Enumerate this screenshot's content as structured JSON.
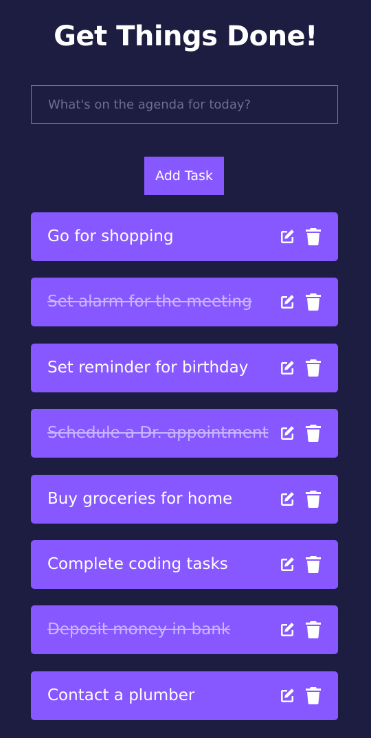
{
  "header": {
    "title": "Get Things Done!"
  },
  "form": {
    "placeholder": "What's on the agenda for today?",
    "add_label": "Add Task"
  },
  "tasks": [
    {
      "label": "Go for shopping",
      "completed": false
    },
    {
      "label": "Set alarm for the meeting",
      "completed": true
    },
    {
      "label": "Set reminder for birthday",
      "completed": false
    },
    {
      "label": "Schedule a Dr. appointment",
      "completed": true
    },
    {
      "label": "Buy groceries for home",
      "completed": false
    },
    {
      "label": "Complete coding tasks",
      "completed": false
    },
    {
      "label": "Deposit money in bank",
      "completed": true
    },
    {
      "label": "Contact a plumber",
      "completed": false
    }
  ],
  "icons": {
    "edit": "pen-to-square-icon",
    "delete": "trash-icon"
  },
  "colors": {
    "background": "#1d1d42",
    "accent": "#8758ff",
    "text": "#ffffff"
  }
}
